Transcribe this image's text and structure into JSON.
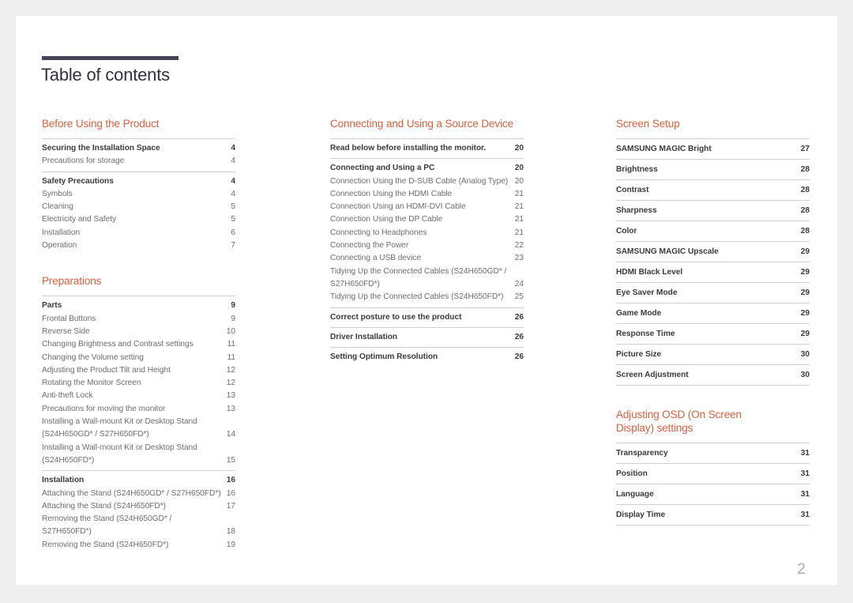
{
  "document": {
    "title": "Table of contents",
    "page_number": "2",
    "accent_color": "#d9603c",
    "rule_color": "#474357",
    "page_bg": "#ffffff",
    "outer_bg": "#efefef"
  },
  "columns": [
    {
      "id": "column-1",
      "sections": [
        {
          "heading": "Before Using the Product",
          "entries": [
            {
              "label": "Securing the Installation Space",
              "page": "4",
              "level": 1,
              "separator": true
            },
            {
              "label": "Precautions for storage",
              "page": "4",
              "level": 2,
              "separator": false
            },
            {
              "label": "Safety Precautions",
              "page": "4",
              "level": 1,
              "separator": true
            },
            {
              "label": "Symbols",
              "page": "4",
              "level": 2,
              "separator": false
            },
            {
              "label": "Cleaning",
              "page": "5",
              "level": 2,
              "separator": false
            },
            {
              "label": "Electricity and Safety",
              "page": "5",
              "level": 2,
              "separator": false
            },
            {
              "label": "Installation",
              "page": "6",
              "level": 2,
              "separator": false
            },
            {
              "label": "Operation",
              "page": "7",
              "level": 2,
              "separator": false
            }
          ]
        },
        {
          "heading": "Preparations",
          "entries": [
            {
              "label": "Parts",
              "page": "9",
              "level": 1,
              "separator": true
            },
            {
              "label": "Frontal Buttons",
              "page": "9",
              "level": 2,
              "separator": false
            },
            {
              "label": "Reverse Side",
              "page": "10",
              "level": 2,
              "separator": false
            },
            {
              "label": "Changing Brightness and Contrast settings",
              "page": "11",
              "level": 2,
              "separator": false
            },
            {
              "label": "Changing the Volume setting",
              "page": "11",
              "level": 2,
              "separator": false
            },
            {
              "label": "Adjusting the Product Tilt and Height",
              "page": "12",
              "level": 2,
              "separator": false
            },
            {
              "label": "Rotating the Monitor Screen",
              "page": "12",
              "level": 2,
              "separator": false
            },
            {
              "label": "Anti-theft Lock",
              "page": "13",
              "level": 2,
              "separator": false
            },
            {
              "label": "Precautions for moving the monitor",
              "page": "13",
              "level": 2,
              "separator": false
            },
            {
              "label": "Installing a Wall-mount Kit or Desktop Stand (S24H650GD* / S27H650FD*)",
              "page": "14",
              "level": 2,
              "separator": false
            },
            {
              "label": "Installing a Wall-mount Kit or Desktop Stand (S24H650FD*)",
              "page": "15",
              "level": 2,
              "separator": false
            },
            {
              "label": "Installation",
              "page": "16",
              "level": 1,
              "separator": true
            },
            {
              "label": "Attaching the Stand (S24H650GD* / S27H650FD*)",
              "page": "16",
              "level": 2,
              "separator": false,
              "tight": true
            },
            {
              "label": "Attaching the Stand (S24H650FD*)",
              "page": "17",
              "level": 2,
              "separator": false
            },
            {
              "label": "Removing the Stand (S24H650GD* / S27H650FD*)",
              "page": "18",
              "level": 2,
              "separator": false
            },
            {
              "label": "Removing the Stand (S24H650FD*)",
              "page": "19",
              "level": 2,
              "separator": false
            }
          ]
        }
      ]
    },
    {
      "id": "column-2",
      "sections": [
        {
          "heading": "Connecting and Using a Source Device",
          "entries": [
            {
              "label": "Read below before installing the monitor.",
              "page": "20",
              "level": 1,
              "separator": true
            },
            {
              "label": "Connecting and Using a PC",
              "page": "20",
              "level": 1,
              "separator": true
            },
            {
              "label": "Connection Using the D-SUB Cable (Analog Type)",
              "page": "20",
              "level": 2,
              "separator": false,
              "tight": true
            },
            {
              "label": "Connection Using the HDMI Cable",
              "page": "21",
              "level": 2,
              "separator": false
            },
            {
              "label": "Connection Using an HDMI-DVI Cable",
              "page": "21",
              "level": 2,
              "separator": false
            },
            {
              "label": "Connection Using the DP Cable",
              "page": "21",
              "level": 2,
              "separator": false
            },
            {
              "label": "Connecting to Headphones",
              "page": "21",
              "level": 2,
              "separator": false
            },
            {
              "label": "Connecting the Power",
              "page": "22",
              "level": 2,
              "separator": false
            },
            {
              "label": "Connecting a USB device",
              "page": "23",
              "level": 2,
              "separator": false
            },
            {
              "label": "Tidying Up the Connected Cables (S24H650GD* / S27H650FD*)",
              "page": "24",
              "level": 2,
              "separator": false
            },
            {
              "label": "Tidying Up the Connected Cables (S24H650FD*)",
              "page": "25",
              "level": 2,
              "separator": false
            },
            {
              "label": "Correct posture to use the product",
              "page": "26",
              "level": 1,
              "separator": true
            },
            {
              "label": "Driver Installation",
              "page": "26",
              "level": 1,
              "separator": true
            },
            {
              "label": "Setting Optimum Resolution",
              "page": "26",
              "level": 1,
              "separator": true
            }
          ]
        }
      ]
    },
    {
      "id": "column-3",
      "sections": [
        {
          "heading": "Screen Setup",
          "entries": [
            {
              "label": "SAMSUNG MAGIC Bright",
              "page": "27",
              "level": 1,
              "separator": true
            },
            {
              "label": "Brightness",
              "page": "28",
              "level": 1,
              "separator": true
            },
            {
              "label": "Contrast",
              "page": "28",
              "level": 1,
              "separator": true
            },
            {
              "label": "Sharpness",
              "page": "28",
              "level": 1,
              "separator": true
            },
            {
              "label": "Color",
              "page": "28",
              "level": 1,
              "separator": true
            },
            {
              "label": "SAMSUNG MAGIC Upscale",
              "page": "29",
              "level": 1,
              "separator": true
            },
            {
              "label": "HDMI Black Level",
              "page": "29",
              "level": 1,
              "separator": true
            },
            {
              "label": "Eye Saver Mode",
              "page": "29",
              "level": 1,
              "separator": true
            },
            {
              "label": "Game Mode",
              "page": "29",
              "level": 1,
              "separator": true
            },
            {
              "label": "Response Time",
              "page": "29",
              "level": 1,
              "separator": true
            },
            {
              "label": "Picture Size",
              "page": "30",
              "level": 1,
              "separator": true
            },
            {
              "label": "Screen Adjustment",
              "page": "30",
              "level": 1,
              "separator": true
            }
          ]
        },
        {
          "heading": "Adjusting OSD (On Screen Display) settings",
          "entries": [
            {
              "label": "Transparency",
              "page": "31",
              "level": 1,
              "separator": true
            },
            {
              "label": "Position",
              "page": "31",
              "level": 1,
              "separator": true
            },
            {
              "label": "Language",
              "page": "31",
              "level": 1,
              "separator": true
            },
            {
              "label": "Display Time",
              "page": "31",
              "level": 1,
              "separator": true
            }
          ]
        }
      ]
    }
  ]
}
